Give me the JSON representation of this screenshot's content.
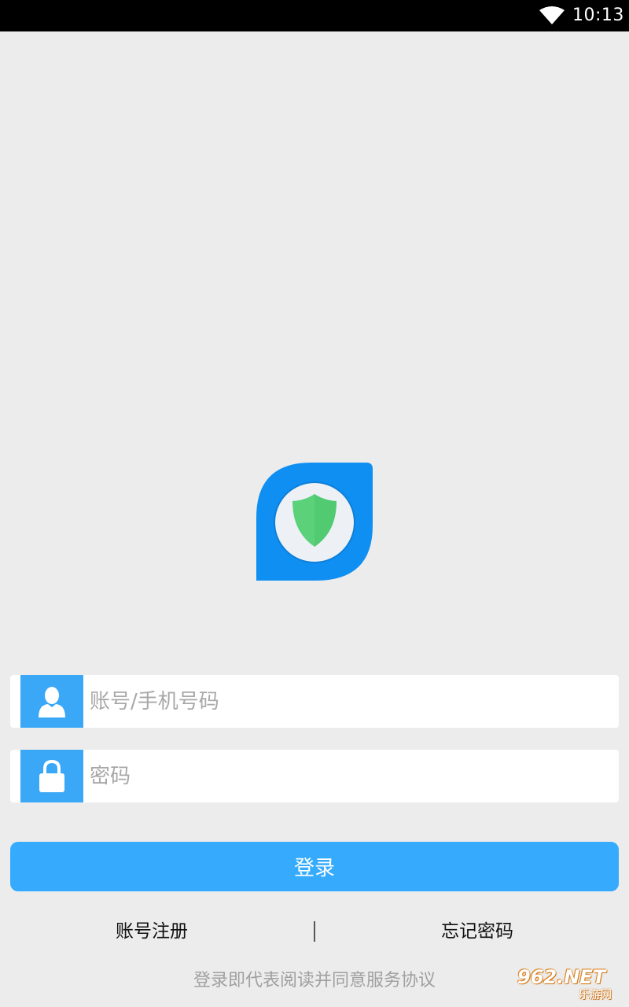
{
  "status_bar": {
    "time": "10:13",
    "icons": [
      "wifi-icon"
    ]
  },
  "logo": {
    "name": "app-logo",
    "shield_color": "#5bd17a",
    "badge_color": "#0f8ff2"
  },
  "form": {
    "account": {
      "placeholder": "账号/手机号码",
      "value": "",
      "icon": "user-icon"
    },
    "password": {
      "placeholder": "密码",
      "value": "",
      "icon": "lock-icon"
    }
  },
  "login_button": {
    "label": "登录",
    "color": "#36abfd"
  },
  "links": {
    "register": "账号注册",
    "forgot": "忘记密码"
  },
  "agreement": "登录即代表阅读并同意服务协议",
  "watermark": {
    "top": "962.NET",
    "bottom": "乐游网"
  }
}
